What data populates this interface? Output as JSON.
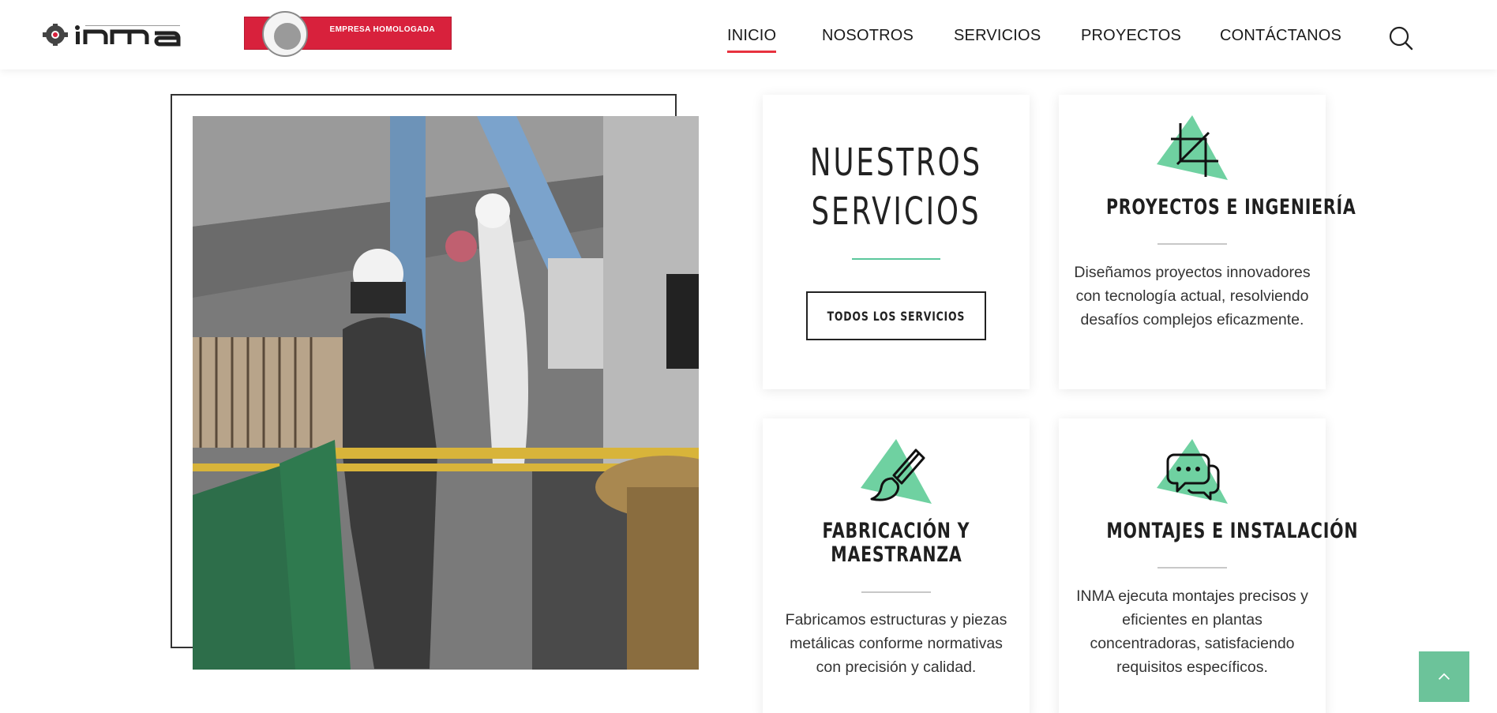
{
  "header": {
    "logo_icons": [
      "inma-logo",
      "bureau-veritas-logo"
    ],
    "badge_text": "EMPRESA HOMOLOGADA",
    "nav": [
      {
        "label": "INICIO",
        "active": true
      },
      {
        "label": "NOSOTROS",
        "active": false
      },
      {
        "label": "SERVICIOS",
        "active": false
      },
      {
        "label": "PROYECTOS",
        "active": false
      },
      {
        "label": "CONTÁCTANOS",
        "active": false
      }
    ],
    "search_icon": "search-icon",
    "active_underline_color": "#e8323f"
  },
  "hero_image": {
    "icon": "workers-photo"
  },
  "services": {
    "heading_line1": "NUESTROS",
    "heading_line2": "SERVICIOS",
    "button_label": "TODOS LOS SERVICIOS",
    "accent_color": "#5bc79c",
    "items": [
      {
        "title": "PROYECTOS E INGENIERÍA",
        "description": "Diseñamos proyectos innovadores con tecnología actual, resolviendo desafíos complejos eficazmente.",
        "icon": "crop-icon"
      },
      {
        "title_line1": "FABRICACIÓN Y",
        "title_line2": "MAESTRANZA",
        "description": "Fabricamos estructuras y piezas metálicas conforme normativas con precisión y calidad.",
        "icon": "paintbrush-icon"
      },
      {
        "title": "MONTAJES E INSTALACIÓN",
        "description": "INMA ejecuta montajes precisos y eficientes en plantas concentradoras, satisfaciendo requisitos específicos.",
        "icon": "chat-bubbles-icon"
      }
    ]
  },
  "scroll_top": {
    "icon": "chevron-up-icon",
    "color": "#6cc39a"
  }
}
